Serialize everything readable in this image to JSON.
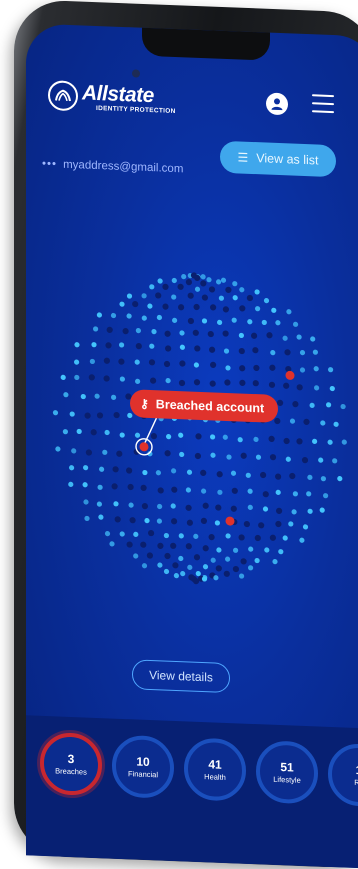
{
  "header": {
    "brand": "Allstate",
    "brand_sub": "IDENTITY PROTECTION",
    "view_as_list": "View as list"
  },
  "account": {
    "email_dots": "•••",
    "email": "myaddress@gmail.com"
  },
  "globe": {
    "tooltip": "Breached account",
    "breach_marker_count": 3
  },
  "actions": {
    "view_details": "View details"
  },
  "categories": [
    {
      "count": "3",
      "label": "Breaches",
      "active": true
    },
    {
      "count": "10",
      "label": "Financial",
      "active": false
    },
    {
      "count": "41",
      "label": "Health",
      "active": false
    },
    {
      "count": "51",
      "label": "Lifestyle",
      "active": false
    },
    {
      "count": "1",
      "label": "Re",
      "active": false
    }
  ],
  "colors": {
    "screen_bg": "#0a2f9e",
    "accent_blue": "#3fa7ec",
    "alert_red": "#e0322c",
    "dot_light": "#45c8ff",
    "dot_dark": "#0a1f6e"
  }
}
